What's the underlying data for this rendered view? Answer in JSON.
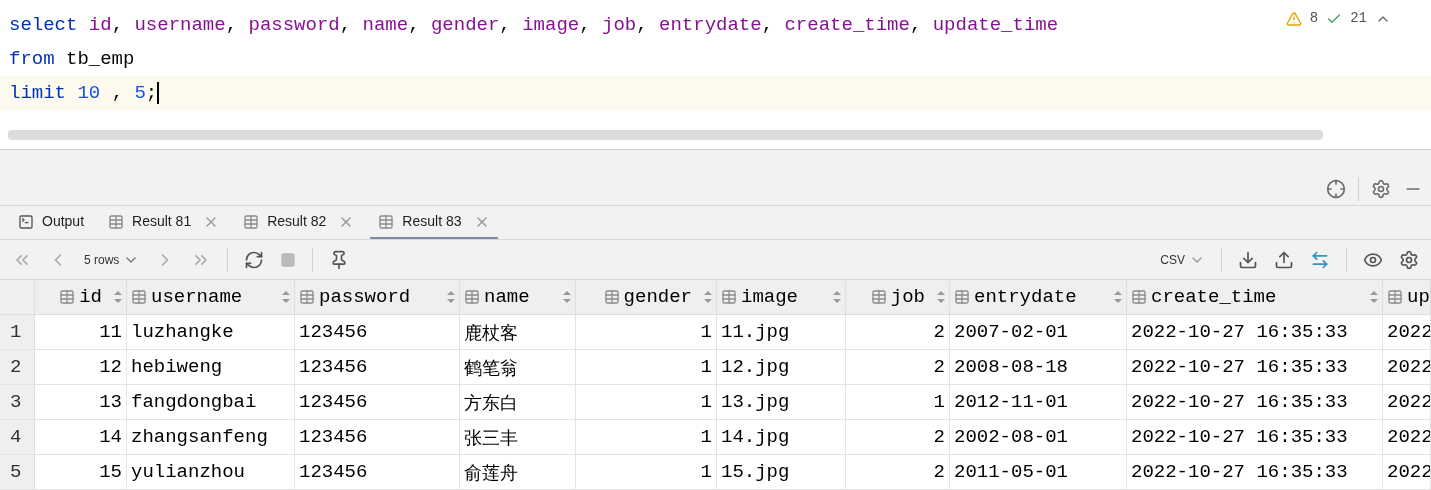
{
  "editor": {
    "lines": [
      {
        "tokens": [
          {
            "kind": "keyword",
            "text": "select "
          },
          {
            "kind": "column",
            "text": "id"
          },
          {
            "kind": "plain",
            "text": ", "
          },
          {
            "kind": "column",
            "text": "username"
          },
          {
            "kind": "plain",
            "text": ", "
          },
          {
            "kind": "column",
            "text": "password"
          },
          {
            "kind": "plain",
            "text": ", "
          },
          {
            "kind": "column",
            "text": "name"
          },
          {
            "kind": "plain",
            "text": ", "
          },
          {
            "kind": "column",
            "text": "gender"
          },
          {
            "kind": "plain",
            "text": ", "
          },
          {
            "kind": "column",
            "text": "image"
          },
          {
            "kind": "plain",
            "text": ", "
          },
          {
            "kind": "column",
            "text": "job"
          },
          {
            "kind": "plain",
            "text": ", "
          },
          {
            "kind": "column",
            "text": "entrydate"
          },
          {
            "kind": "plain",
            "text": ", "
          },
          {
            "kind": "column",
            "text": "create_time"
          },
          {
            "kind": "plain",
            "text": ", "
          },
          {
            "kind": "column",
            "text": "update_time"
          }
        ],
        "current": false
      },
      {
        "tokens": [
          {
            "kind": "keyword",
            "text": "from"
          },
          {
            "kind": "plain",
            "text": " tb_emp"
          }
        ],
        "current": false
      },
      {
        "tokens": [
          {
            "kind": "keyword",
            "text": "limit "
          },
          {
            "kind": "number",
            "text": "10"
          },
          {
            "kind": "plain",
            "text": " , "
          },
          {
            "kind": "number",
            "text": "5"
          },
          {
            "kind": "plain",
            "text": ";"
          }
        ],
        "current": true
      }
    ],
    "warnings": "8",
    "checks": "21"
  },
  "tabs": [
    {
      "kind": "output",
      "label": "Output",
      "selected": false
    },
    {
      "kind": "result",
      "label": "Result 81",
      "selected": false
    },
    {
      "kind": "result",
      "label": "Result 82",
      "selected": false
    },
    {
      "kind": "result",
      "label": "Result 83",
      "selected": true
    }
  ],
  "toolbar": {
    "rows": "5 rows",
    "format": "CSV"
  },
  "table": {
    "columns": [
      {
        "label": "id",
        "kind": "numeric"
      },
      {
        "label": "username",
        "kind": "text"
      },
      {
        "label": "password",
        "kind": "text"
      },
      {
        "label": "name",
        "kind": "text"
      },
      {
        "label": "gender",
        "kind": "numeric"
      },
      {
        "label": "image",
        "kind": "text"
      },
      {
        "label": "job",
        "kind": "numeric"
      },
      {
        "label": "entrydate",
        "kind": "text"
      },
      {
        "label": "create_time",
        "kind": "text"
      },
      {
        "label": "up",
        "kind": "cut"
      }
    ],
    "rows": [
      {
        "number": "1",
        "cells": [
          "11",
          "luzhangke",
          "123456",
          "鹿杖客",
          "1",
          "11.jpg",
          "2",
          "2007-02-01",
          "2022-10-27 16:35:33",
          "2022"
        ]
      },
      {
        "number": "2",
        "cells": [
          "12",
          "hebiweng",
          "123456",
          "鹤笔翁",
          "1",
          "12.jpg",
          "2",
          "2008-08-18",
          "2022-10-27 16:35:33",
          "2022"
        ]
      },
      {
        "number": "3",
        "cells": [
          "13",
          "fangdongbai",
          "123456",
          "方东白",
          "1",
          "13.jpg",
          "1",
          "2012-11-01",
          "2022-10-27 16:35:33",
          "2022"
        ]
      },
      {
        "number": "4",
        "cells": [
          "14",
          "zhangsanfeng",
          "123456",
          "张三丰",
          "1",
          "14.jpg",
          "2",
          "2002-08-01",
          "2022-10-27 16:35:33",
          "2022"
        ]
      },
      {
        "number": "5",
        "cells": [
          "15",
          "yulianzhou",
          "123456",
          "俞莲舟",
          "1",
          "15.jpg",
          "2",
          "2011-05-01",
          "2022-10-27 16:35:33",
          "2022"
        ]
      }
    ]
  }
}
